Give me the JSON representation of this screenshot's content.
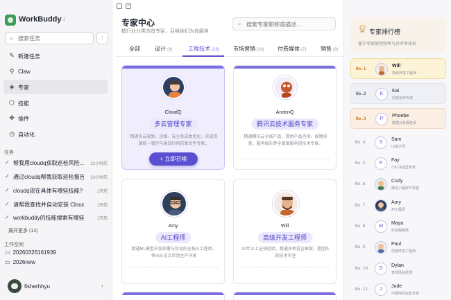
{
  "app": {
    "name": "WorkBuddy",
    "version": "v4.7.2"
  },
  "sidebar": {
    "search_placeholder": "搜索任务",
    "nav": [
      {
        "label": "新建任务",
        "icon": "edit-icon"
      },
      {
        "label": "Claw",
        "icon": "link-icon"
      },
      {
        "label": "专家",
        "icon": "layers-icon",
        "active": true
      },
      {
        "label": "技能",
        "icon": "cube-icon"
      },
      {
        "label": "插件",
        "icon": "puzzle-icon"
      },
      {
        "label": "自动化",
        "icon": "clock-icon"
      }
    ],
    "tasks_label": "任务",
    "tasks": [
      {
        "title": "帮我用cloudq获取巡检风险...",
        "time": "22小时前"
      },
      {
        "title": "通过cloudq帮我获取巡检报告",
        "time": "23小时前"
      },
      {
        "title": "cloudq现在具体有哪些技能?",
        "time": "1天前"
      },
      {
        "title": "请帮我查找并自动安装 CloudQ ...",
        "time": "1天前"
      },
      {
        "title": "workbuddy的技能搜索有哪些来...",
        "time": "1天前"
      }
    ],
    "more_label": "展开更多 (13)",
    "workspace_label": "工作空间",
    "workspaces": [
      "20260326161939",
      "2026new"
    ],
    "user_name": "fisherhhyu"
  },
  "main": {
    "title": "专家中心",
    "subtitle": "按行业分类浏览专家，召唤他们为你服务",
    "search_placeholder": "搜索专家职称或描述...",
    "tabs": [
      {
        "label": "全部",
        "count": ""
      },
      {
        "label": "设计",
        "count": "(8)"
      },
      {
        "label": "工程技术",
        "count": "(23)",
        "active": true
      },
      {
        "label": "市场营销",
        "count": "(26)"
      },
      {
        "label": "付费媒体",
        "count": "(7)"
      },
      {
        "label": "销售",
        "count": "(8)"
      }
    ],
    "cards": [
      {
        "name": "CloudQ",
        "role": "多云管理专家",
        "desc": "精通多云规划、运维、安全及成本优化，实现资源统一管控与高效协同的复合型专家。",
        "button": "+ 立即召唤"
      },
      {
        "name": "AndonQ",
        "role": "腾讯云技术服务专家",
        "desc": "精通腾讯云全线产品，提供产品咨询、故障排查、服务报告等全维度服务的技术专家。"
      },
      {
        "name": "Amy",
        "role": "AI工程师",
        "desc": "精通ML模型开发部署与优化的全栈AI工程师，将AI从论文带到生产环境"
      },
      {
        "name": "Will",
        "role": "高级开发工程师",
        "desc": "10年以上全栈经验，精通多种语言框架，是团队的技术中坚"
      }
    ]
  },
  "ranking": {
    "title": "专家排行榜",
    "subtitle": "基于专家使用频率与好评率排名",
    "rows": [
      {
        "no": "No.1",
        "name": "Will",
        "role": "高级开发工程师",
        "initial": ""
      },
      {
        "no": "No.2",
        "name": "Kai",
        "role": "内容创作专家",
        "initial": "K"
      },
      {
        "no": "No.3",
        "name": "Phoebe",
        "role": "数据分析报告师",
        "initial": "P"
      },
      {
        "no": "No.4",
        "name": "Sam",
        "role": "UI设计师",
        "initial": "S"
      },
      {
        "no": "No.5",
        "name": "Fay",
        "role": "小红书运营专家",
        "initial": "F"
      },
      {
        "no": "No.6",
        "name": "Cody",
        "role": "微信小程序开发者",
        "initial": ""
      },
      {
        "no": "No.7",
        "name": "Amy",
        "role": "AI工程师",
        "initial": ""
      },
      {
        "no": "No.8",
        "name": "Maya",
        "role": "抖音策略师",
        "initial": "M"
      },
      {
        "no": "No.9",
        "name": "Paul",
        "role": "前端开发工程师",
        "initial": ""
      },
      {
        "no": "No.10",
        "name": "Dylan",
        "role": "表现场总经理",
        "initial": "D"
      },
      {
        "no": "No.11",
        "name": "Jude",
        "role": "中国电商运营专家",
        "initial": "J"
      }
    ]
  }
}
